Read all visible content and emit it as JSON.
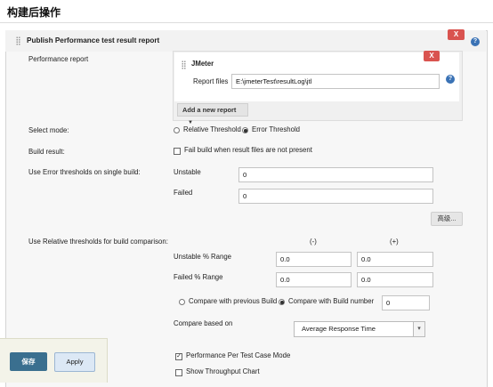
{
  "page": {
    "title": "构建后操作"
  },
  "section": {
    "title": "Publish Performance test result report",
    "delete_label": "X",
    "help_label": "?"
  },
  "performance_report": {
    "label": "Performance report",
    "reporter": {
      "name": "JMeter",
      "delete_label": "X",
      "report_files_label": "Report files",
      "report_files_value": "E:\\jmeterTest\\resultLog\\jtl",
      "help_label": "?"
    },
    "add_button_label": "Add a new report",
    "add_button_arrow": "▼"
  },
  "select_mode": {
    "label": "Select mode:",
    "options": [
      "Relative Threshold",
      "Error Threshold"
    ],
    "selected": "Error Threshold"
  },
  "build_result": {
    "label": "Build result:",
    "checkbox_label": "Fail build when result files are not present",
    "checked": false
  },
  "error_thresholds": {
    "label": "Use Error thresholds on single build:",
    "unstable_label": "Unstable",
    "unstable_value": "0",
    "failed_label": "Failed",
    "failed_value": "0"
  },
  "advanced_button_label": "高级...",
  "relative_thresholds": {
    "label": "Use Relative thresholds for build comparison:",
    "minus_header": "(-)",
    "plus_header": "(+)",
    "unstable_label": "Unstable % Range",
    "unstable_minus": "0.0",
    "unstable_plus": "0.0",
    "failed_label": "Failed % Range",
    "failed_minus": "0.0",
    "failed_plus": "0.0",
    "compare_previous_label": "Compare with previous Build",
    "compare_number_label": "Compare with Build number",
    "compare_selected": "Compare with Build number",
    "build_number_value": "0",
    "compare_based_label": "Compare based on",
    "compare_based_value": "Average Response Time",
    "select_arrow": "▾"
  },
  "per_test_case": {
    "label": "Performance Per Test Case Mode",
    "checked": true
  },
  "throughput_chart": {
    "label": "Show Throughput Chart",
    "checked": false
  },
  "footer": {
    "save_label": "保存",
    "apply_label": "Apply"
  }
}
